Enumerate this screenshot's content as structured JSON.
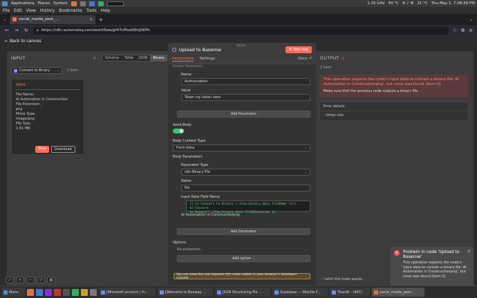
{
  "os_panel": {
    "applications": "Applications",
    "places": "Places",
    "system": "System",
    "cpu": "1.15",
    "cpu_unit": "GHz",
    "temp": "44 °C",
    "weather": "21 °C",
    "datetime": "Thu May 1, 7:09:39 PM"
  },
  "browser_menu": [
    "File",
    "Edit",
    "View",
    "History",
    "Bookmarks",
    "Tools",
    "Help"
  ],
  "tab": {
    "title": "social_media_post_..."
  },
  "url": "https://n8n.automatey.com/workflow/gtH7cMxdS6hjDKPn",
  "workspace": {
    "back_label": "Back to canvas"
  },
  "input_panel": {
    "title": "INPUT",
    "view_tabs": [
      "Schema",
      "Table",
      "JSON",
      "Binary"
    ],
    "node_select": "Convert to Binary",
    "item_count": "1 item",
    "card": {
      "title": "data",
      "lines": [
        "File Name:",
        "AI Automation in Construction",
        "File Extension:",
        "png",
        "Mime Type:",
        "image/png",
        "File Size:",
        "1.91 MB"
      ],
      "view_label": "View",
      "download_label": "Download"
    }
  },
  "modal": {
    "title": "Upload to Baserow",
    "test_step": "Test step",
    "tabs": [
      "Parameters",
      "Settings"
    ],
    "docs": "Docs",
    "scroll_label": "Header Parameters",
    "name_label": "Name",
    "name_value": "Authorization",
    "value_label": "Value",
    "value_value": "Token my token here",
    "add_parameter": "Add Parameter",
    "send_body_label": "Send Body",
    "body_content_type_label": "Body Content Type",
    "body_content_type_value": "Form-Data",
    "body_parameters_label": "Body Parameters",
    "parameter_type_label": "Parameter Type",
    "parameter_type_value": "n8n Binary File",
    "name2_label": "Name",
    "name2_value": "file",
    "input_data_label": "Input Data Field Name",
    "code_line1": "{{ $('Convert to Binary').item.binary.data.fileName }}{{ $('Convert",
    "code_line2": "to Binary').item.binary.data.fileExtension }}",
    "resolved_value": "AI Automation in Constructionpng",
    "add_parameter2": "Add Parameter",
    "options_label": "Options",
    "no_properties": "No properties",
    "add_option": "Add option",
    "console_note": "You can view the raw requests this node makes in your browser's developer console"
  },
  "output_panel": {
    "title": "OUTPUT",
    "item_count": "1 item",
    "error_message": "This operation expects the node's input data to contain a binary file 'AI Automation in Constructionpng', but none was found [item 0]",
    "error_hint": "Make sure that the previous node outputs a binary file",
    "details_header": "Error details",
    "other_info": "Other info",
    "wish_note": "I wish this node would..."
  },
  "toast": {
    "title": "Problem in node 'Upload to Baserow'",
    "body": "This operation expects the node's input data to contain a binary file 'AI Automation in Constructionpng', but none was found [item 0]"
  },
  "taskbar": {
    "menu": "Menu",
    "tasks": [
      "[Microsoft account | H...",
      "[Welcome to Runway ...",
      "JSON Structuring Fix ...",
      "Supabase — Mozilla F...",
      "TitanAI - (497)",
      "social_media_post..."
    ]
  }
}
